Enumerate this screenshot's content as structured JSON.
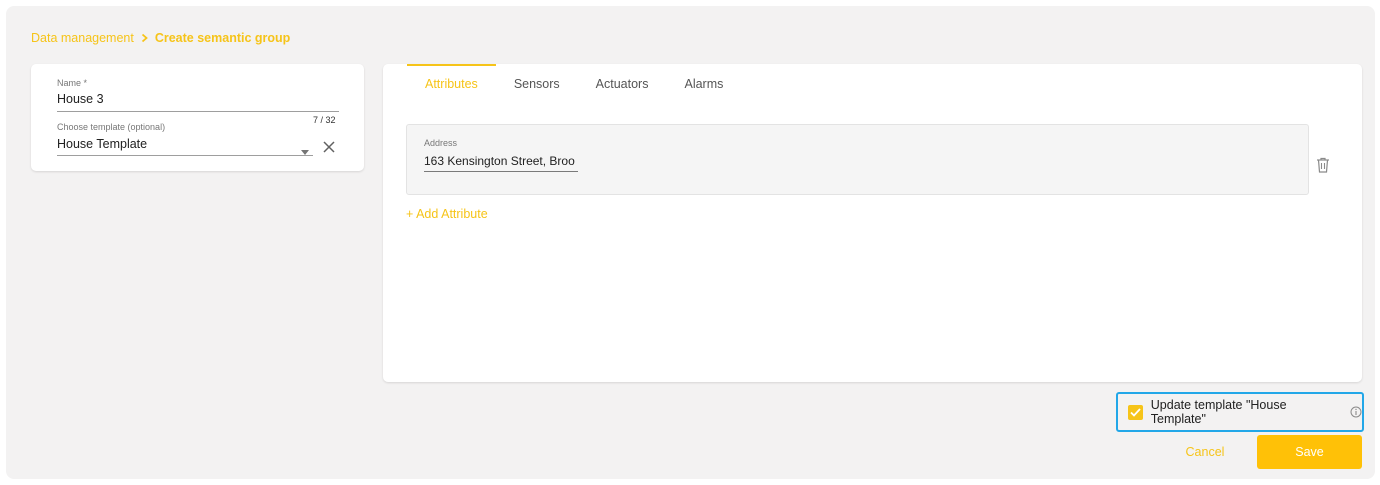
{
  "breadcrumb": {
    "parent": "Data management",
    "current": "Create semantic group"
  },
  "group_form": {
    "name_label": "Name *",
    "name_value": "House 3",
    "name_counter": "7 / 32",
    "template_label": "Choose template (optional)",
    "template_value": "House Template"
  },
  "tabs": [
    {
      "label": "Attributes",
      "active": true
    },
    {
      "label": "Sensors",
      "active": false
    },
    {
      "label": "Actuators",
      "active": false
    },
    {
      "label": "Alarms",
      "active": false
    }
  ],
  "attributes": {
    "items": [
      {
        "label": "Address",
        "value": "163 Kensington Street, Broo"
      }
    ],
    "add_label": "+ Add Attribute"
  },
  "footer": {
    "update_template_label": "Update template \"House Template\"",
    "update_template_checked": true,
    "cancel_label": "Cancel",
    "save_label": "Save"
  },
  "colors": {
    "accent": "#f6c419",
    "save_button": "#ffc107",
    "focus_border": "#22a7e8",
    "page_background": "#f3f2f2"
  },
  "icons": [
    "chevron-right-icon",
    "dropdown-arrow-icon",
    "clear-icon",
    "trash-icon",
    "checkmark-icon",
    "info-icon"
  ]
}
